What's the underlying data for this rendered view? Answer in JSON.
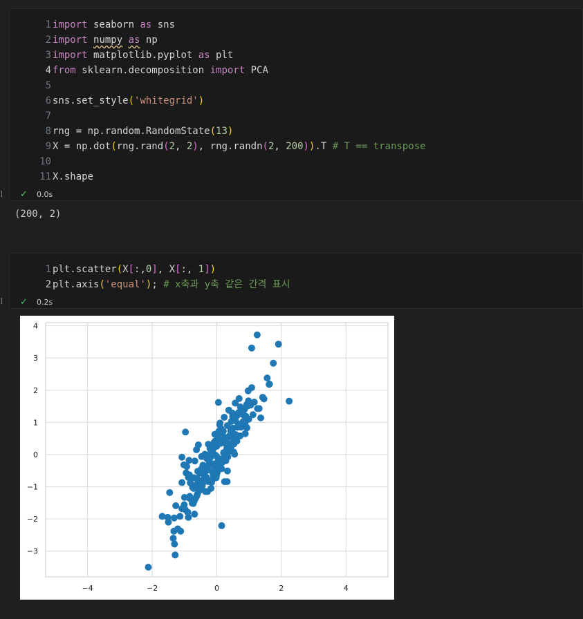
{
  "cell1": {
    "lines": [
      {
        "n": "1",
        "tokens": [
          {
            "t": "import",
            "c": "kw"
          },
          {
            "t": " seaborn ",
            "c": "fn"
          },
          {
            "t": "as",
            "c": "kw"
          },
          {
            "t": " sns",
            "c": "fn"
          }
        ]
      },
      {
        "n": "2",
        "tokens": [
          {
            "t": "import",
            "c": "kw"
          },
          {
            "t": " ",
            "c": "fn"
          },
          {
            "t": "numpy",
            "c": "fn squig"
          },
          {
            "t": " ",
            "c": "fn"
          },
          {
            "t": "as",
            "c": "kw squig"
          },
          {
            "t": " np",
            "c": "fn"
          }
        ]
      },
      {
        "n": "3",
        "tokens": [
          {
            "t": "import",
            "c": "kw"
          },
          {
            "t": " matplotlib.pyplot ",
            "c": "fn"
          },
          {
            "t": "as",
            "c": "kw"
          },
          {
            "t": " plt",
            "c": "fn"
          }
        ]
      },
      {
        "n": "4",
        "tokens": [
          {
            "t": "from",
            "c": "kw"
          },
          {
            "t": " sklearn.decomposition ",
            "c": "fn"
          },
          {
            "t": "import",
            "c": "kw"
          },
          {
            "t": " PCA",
            "c": "fn"
          }
        ]
      },
      {
        "n": "5",
        "tokens": []
      },
      {
        "n": "6",
        "tokens": [
          {
            "t": "sns.set_style",
            "c": "fn"
          },
          {
            "t": "(",
            "c": "par1"
          },
          {
            "t": "'whitegrid'",
            "c": "str"
          },
          {
            "t": ")",
            "c": "par1"
          }
        ]
      },
      {
        "n": "7",
        "tokens": []
      },
      {
        "n": "8",
        "tokens": [
          {
            "t": "rng = np.random.RandomState",
            "c": "fn"
          },
          {
            "t": "(",
            "c": "par1"
          },
          {
            "t": "13",
            "c": "num"
          },
          {
            "t": ")",
            "c": "par1"
          }
        ]
      },
      {
        "n": "9",
        "tokens": [
          {
            "t": "X = np.dot",
            "c": "fn"
          },
          {
            "t": "(",
            "c": "par1"
          },
          {
            "t": "rng.rand",
            "c": "fn"
          },
          {
            "t": "(",
            "c": "par2"
          },
          {
            "t": "2",
            "c": "num"
          },
          {
            "t": ", ",
            "c": "fn"
          },
          {
            "t": "2",
            "c": "num"
          },
          {
            "t": ")",
            "c": "par2"
          },
          {
            "t": ", rng.randn",
            "c": "fn"
          },
          {
            "t": "(",
            "c": "par2"
          },
          {
            "t": "2",
            "c": "num"
          },
          {
            "t": ", ",
            "c": "fn"
          },
          {
            "t": "200",
            "c": "num"
          },
          {
            "t": ")",
            "c": "par2"
          },
          {
            "t": ")",
            "c": "par1"
          },
          {
            "t": ".T ",
            "c": "fn"
          },
          {
            "t": "# T == transpose",
            "c": "cmt"
          }
        ]
      },
      {
        "n": "10",
        "tokens": []
      },
      {
        "n": "11",
        "tokens": [
          {
            "t": "X.shape",
            "c": "fn"
          }
        ]
      }
    ],
    "status_check": "✓",
    "status_time": "0.0s",
    "bracket": "]"
  },
  "output1": "(200, 2)",
  "cell2": {
    "lines": [
      {
        "n": "1",
        "tokens": [
          {
            "t": "plt.scatter",
            "c": "fn"
          },
          {
            "t": "(",
            "c": "par1"
          },
          {
            "t": "X",
            "c": "fn"
          },
          {
            "t": "[",
            "c": "par2"
          },
          {
            "t": ":,",
            "c": "fn"
          },
          {
            "t": "0",
            "c": "num"
          },
          {
            "t": "]",
            "c": "par2"
          },
          {
            "t": ", X",
            "c": "fn"
          },
          {
            "t": "[",
            "c": "par2"
          },
          {
            "t": ":, ",
            "c": "fn"
          },
          {
            "t": "1",
            "c": "num"
          },
          {
            "t": "]",
            "c": "par2"
          },
          {
            "t": ")",
            "c": "par1"
          }
        ]
      },
      {
        "n": "2",
        "tokens": [
          {
            "t": "plt.axis",
            "c": "fn"
          },
          {
            "t": "(",
            "c": "par1"
          },
          {
            "t": "'equal'",
            "c": "str"
          },
          {
            "t": ")",
            "c": "par1"
          },
          {
            "t": "; ",
            "c": "fn"
          },
          {
            "t": "# x축과 y축 같은 간격 표시",
            "c": "cmt"
          }
        ]
      }
    ],
    "status_check": "✓",
    "status_time": "0.2s",
    "bracket": "]"
  },
  "chart_data": {
    "type": "scatter",
    "xlim": [
      -5.3,
      5.3
    ],
    "ylim": [
      -3.8,
      4.1
    ],
    "xticks": [
      -4,
      -2,
      0,
      2,
      4
    ],
    "yticks": [
      -3,
      -2,
      -1,
      0,
      1,
      2,
      3,
      4
    ],
    "xtick_labels": [
      "−4",
      "−2",
      "0",
      "2",
      "4"
    ],
    "ytick_labels": [
      "−3",
      "−2",
      "−1",
      "0",
      "1",
      "2",
      "3",
      "4"
    ],
    "grid": true,
    "point_color": "#1f77b4",
    "series": [
      {
        "x": [
          -2.12,
          -1.29,
          -1.31,
          -1.35,
          -1.33,
          -1.5,
          -1.52,
          -1.69,
          -1.12,
          -1.32,
          -1.46,
          -0.88,
          -0.98,
          -1.01,
          -0.84,
          -0.78,
          -1.0,
          -1.27,
          -1.08,
          -0.85,
          -0.62,
          -0.52,
          -0.62,
          -0.72,
          -0.84,
          -0.73,
          -0.69,
          -0.93,
          -0.86,
          -0.43,
          -0.59,
          -0.71,
          -0.49,
          -0.35,
          -0.18,
          -0.27,
          -0.38,
          -0.41,
          -0.24,
          -0.1,
          0.01,
          -0.13,
          -0.3,
          -0.18,
          -0.04,
          0.0,
          0.08,
          0.11,
          0.07,
          0.16,
          0.22,
          0.31,
          0.27,
          0.39,
          0.42,
          0.47,
          0.5,
          0.58,
          0.63,
          0.68,
          0.73,
          0.79,
          0.86,
          0.93,
          0.98,
          1.08,
          1.26,
          1.42,
          1.56,
          1.75,
          1.91,
          2.24,
          1.62,
          1.25,
          1.08,
          1.12,
          0.96,
          0.9,
          0.81,
          0.75,
          0.66,
          0.59,
          0.54,
          0.44,
          0.41,
          0.34,
          0.3,
          0.26,
          0.18,
          0.13,
          0.09,
          0.06,
          0.02,
          -0.05,
          -0.09,
          -0.14,
          -0.2,
          -0.24,
          -0.28,
          -0.33,
          -0.39,
          -0.45,
          -0.5,
          -0.55,
          -0.6,
          -0.66,
          -0.7,
          -0.75,
          -0.82,
          -0.88,
          -0.95,
          -1.02,
          -1.08,
          -1.14,
          -1.21,
          -0.97,
          -0.63,
          -0.47,
          -0.26,
          -0.06,
          0.1,
          0.23,
          0.37,
          0.48,
          0.57,
          0.69,
          0.78,
          0.88,
          0.99,
          1.05,
          1.16,
          1.31,
          1.46,
          1.63,
          0.93,
          0.72,
          0.53,
          0.35,
          0.19,
          0.04,
          -0.12,
          -0.31,
          -0.44,
          -0.53,
          -0.62,
          -0.76,
          -0.9,
          -0.35,
          -0.21,
          -0.08,
          0.06,
          0.2,
          0.33,
          0.45,
          0.61,
          0.77,
          0.52,
          0.28,
          0.15,
          -0.01,
          -0.16,
          -0.32,
          -0.48,
          -0.68,
          -0.25,
          0.0,
          0.24,
          0.41,
          0.64,
          0.84,
          1.02,
          0.72,
          0.38,
          0.12,
          -0.14,
          -0.4,
          -0.57,
          -1.08,
          0.05,
          0.43,
          0.58,
          0.91,
          0.37,
          -0.02,
          -0.29,
          0.15,
          0.62,
          0.49,
          0.21,
          -0.06,
          -0.37,
          0.79,
          0.97,
          1.36,
          0.55,
          0.33,
          -0.11,
          0.67,
          0.26,
          -0.46,
          -0.18,
          0.01,
          0.32,
          0.88
        ],
        "y": [
          -3.5,
          -3.12,
          -2.78,
          -2.6,
          -2.38,
          -2.1,
          -1.95,
          -1.92,
          -2.38,
          -1.97,
          -1.18,
          -1.95,
          -1.71,
          -1.56,
          -1.3,
          -1.41,
          -1.33,
          -1.59,
          -0.87,
          -0.63,
          -0.74,
          -0.58,
          -0.92,
          -1.05,
          -1.36,
          -1.52,
          -1.85,
          -0.37,
          -0.18,
          -0.33,
          -0.52,
          -0.72,
          -0.92,
          -1.15,
          -1.05,
          -0.84,
          -0.66,
          -0.49,
          -0.31,
          -0.29,
          -0.56,
          -0.77,
          -0.13,
          0.08,
          -0.02,
          0.26,
          0.42,
          -0.14,
          -0.45,
          -0.25,
          0.05,
          0.19,
          0.43,
          0.58,
          0.34,
          0.71,
          0.82,
          1.05,
          1.22,
          1.31,
          1.48,
          1.34,
          1.41,
          1.56,
          1.67,
          2.08,
          1.43,
          1.78,
          2.38,
          2.84,
          3.43,
          1.66,
          2.18,
          3.72,
          3.31,
          1.24,
          1.51,
          1.19,
          1.02,
          0.85,
          0.95,
          0.62,
          0.46,
          0.25,
          0.11,
          -0.07,
          0.31,
          0.52,
          0.67,
          0.81,
          0.93,
          0.72,
          0.55,
          0.42,
          0.21,
          0.08,
          -0.09,
          -0.21,
          -0.35,
          -0.5,
          -0.63,
          -0.8,
          -0.97,
          -1.11,
          -1.23,
          -1.36,
          -1.44,
          -1.02,
          -0.88,
          -0.71,
          -0.57,
          -0.32,
          -1.68,
          -1.92,
          -2.31,
          0.7,
          0.15,
          -0.06,
          0.32,
          0.63,
          0.98,
          1.16,
          1.38,
          1.29,
          1.6,
          1.74,
          1.26,
          1.01,
          1.1,
          1.54,
          1.63,
          1.43,
          1.73,
          2.19,
          0.83,
          0.58,
          0.33,
          0.13,
          -0.13,
          -0.36,
          -0.57,
          -0.78,
          -0.91,
          -1.11,
          -1.29,
          -1.51,
          -1.79,
          -0.03,
          0.19,
          0.38,
          0.51,
          0.73,
          0.9,
          1.03,
          1.2,
          1.4,
          0.08,
          -0.19,
          -0.44,
          -0.65,
          -0.86,
          -0.71,
          -0.45,
          -0.2,
          -0.48,
          -0.06,
          -0.84,
          0.22,
          0.85,
          1.22,
          1.58,
          0.88,
          0.55,
          0.35,
          0.12,
          -0.06,
          0.3,
          -0.08,
          1.62,
          0.74,
          0.51,
          0.86,
          0.17,
          -0.72,
          -1.15,
          -2.21,
          0.42,
          1.18,
          0.06,
          -0.39,
          0.01,
          1.33,
          1.98,
          1.14,
          0.01,
          -0.51,
          -0.62,
          0.87,
          0.48,
          -0.99,
          0.27,
          -0.25,
          -0.84,
          0.65
        ]
      }
    ]
  }
}
